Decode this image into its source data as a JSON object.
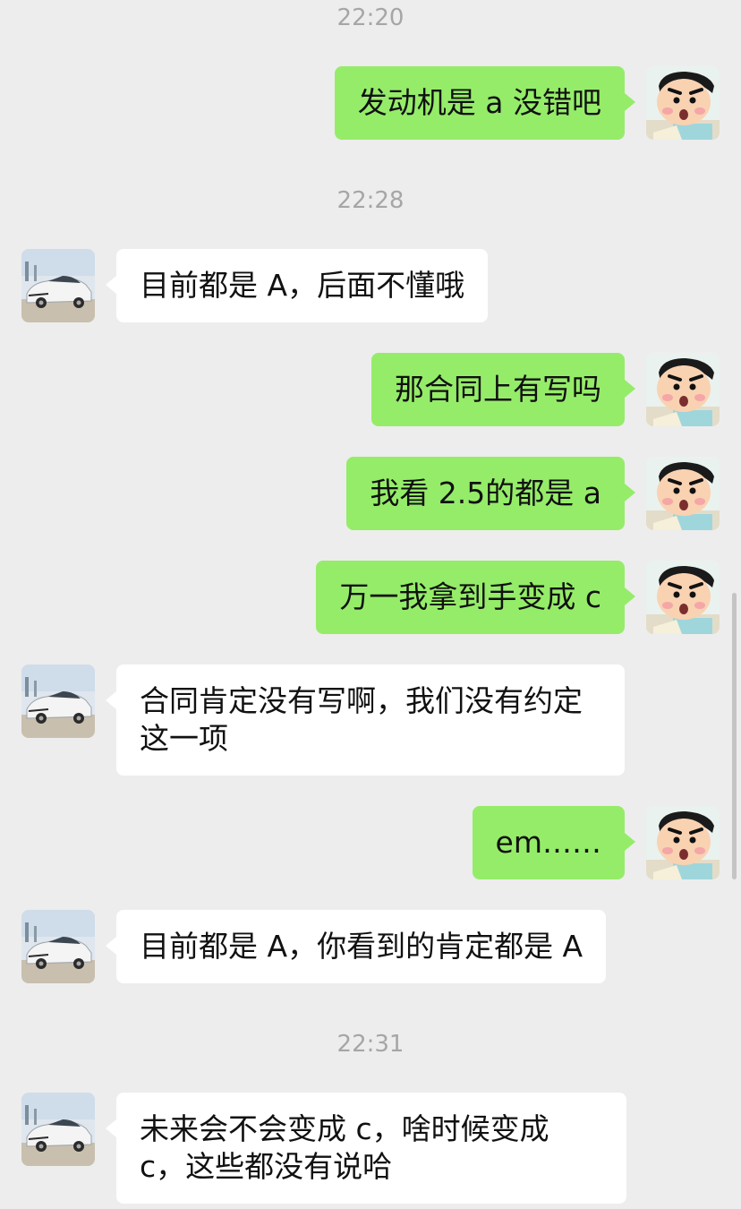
{
  "colors": {
    "background": "#ededed",
    "bubble_self": "#95ec69",
    "bubble_other": "#ffffff",
    "timestamp": "#a6a6a6"
  },
  "avatars": {
    "self": "cartoon-boy-avatar-icon",
    "other": "white-sedan-car-avatar-icon"
  },
  "timestamps": [
    "22:20",
    "22:28",
    "22:31"
  ],
  "messages": [
    {
      "side": "self",
      "text": "发动机是 a 没错吧"
    },
    {
      "side": "other",
      "text": "目前都是 A，后面不懂哦"
    },
    {
      "side": "self",
      "text": "那合同上有写吗"
    },
    {
      "side": "self",
      "text": "我看 2.5的都是 a"
    },
    {
      "side": "self",
      "text": "万一我拿到手变成 c"
    },
    {
      "side": "other",
      "text": "合同肯定没有写啊，我们没有约定这一项"
    },
    {
      "side": "self",
      "text": "em……"
    },
    {
      "side": "other",
      "text": "目前都是 A，你看到的肯定都是 A"
    },
    {
      "side": "other",
      "text": "未来会不会变成 c，啥时候变成 c，这些都没有说哈"
    }
  ]
}
